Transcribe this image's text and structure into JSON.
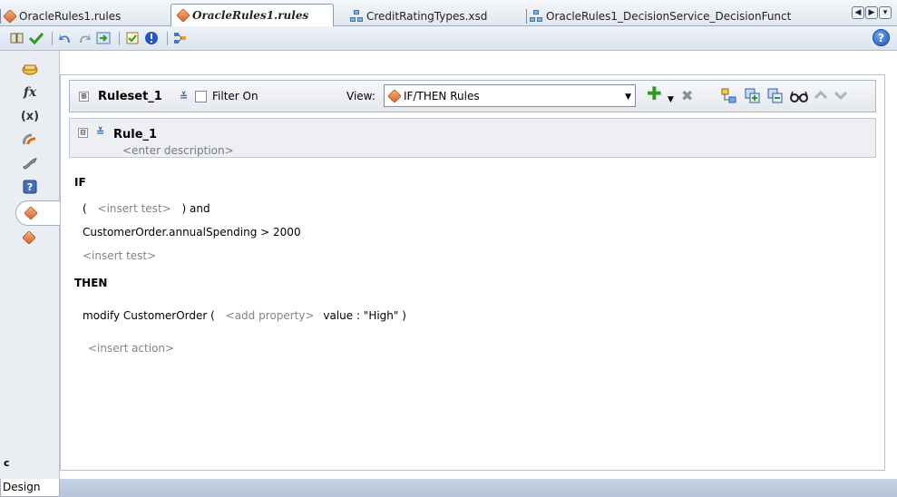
{
  "tabs": [
    {
      "label": "OracleRules1.rules",
      "icon": "rules-icon",
      "active": false
    },
    {
      "label": "OracleRules1.rules",
      "icon": "rules-icon",
      "active": true
    },
    {
      "label": "CreditRatingTypes.xsd",
      "icon": "schema-icon",
      "active": false
    },
    {
      "label": "OracleRules1_DecisionService_DecisionFunct",
      "icon": "schema-icon",
      "active": false
    }
  ],
  "tab_nav": {
    "prev": "◀",
    "next": "▶",
    "menu": "▾"
  },
  "toolbar": {
    "help_label": "?"
  },
  "sidebar": {
    "icons": [
      "ruleset-sidebar-icon",
      "function-icon",
      "variable-icon",
      "links-icon",
      "decision-function-icon",
      "help-sidebar-icon",
      "ruleset-rules-icon",
      "ruleset-rules-icon-2"
    ],
    "function_glyph": "fx",
    "variable_glyph": "(x)",
    "collapsed_label": "c"
  },
  "ruleset": {
    "expander": "⊞",
    "name": "Ruleset_1",
    "filter_label": "Filter On",
    "view_label": "View:",
    "view_value": "IF/THEN Rules"
  },
  "rule": {
    "expander": "⊟",
    "name": "Rule_1",
    "description": "<enter description>"
  },
  "if_block": {
    "keyword": "IF",
    "open_paren": "(",
    "insert_test_1": "<insert test>",
    "close_and": ")  and",
    "condition": "CustomerOrder.annualSpending  >  2000",
    "insert_test_2": "<insert test>"
  },
  "then_block": {
    "keyword": "THEN",
    "action_prefix": "modify CustomerOrder (",
    "add_property": "<add property>",
    "action_suffix": "value : \"High\"  )",
    "insert_action": "<insert action>"
  },
  "bottom": {
    "design_tab": "Design"
  },
  "colors": {
    "accent": "#2b5db5",
    "add_green": "#2e9b1e",
    "delete_gray": "#8a8f98",
    "rule_orange": "#d4642a"
  }
}
